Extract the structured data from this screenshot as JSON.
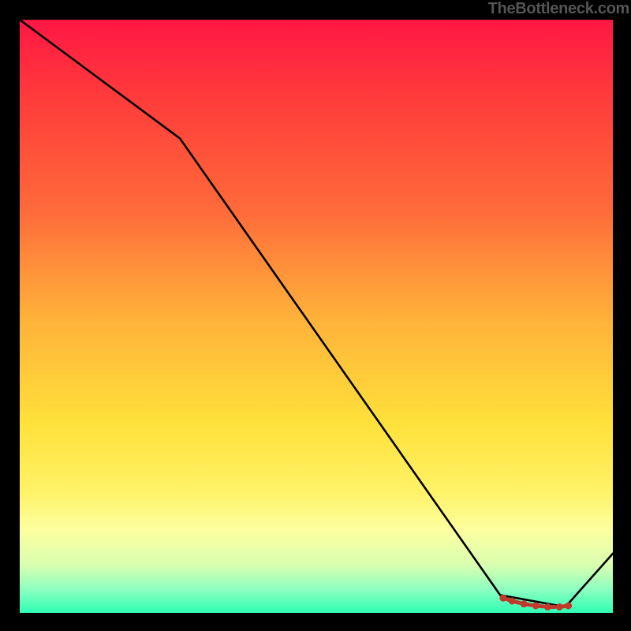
{
  "watermark": "TheBottleneck.com",
  "chart_data": {
    "type": "line",
    "title": "",
    "xlabel": "",
    "ylabel": "",
    "xlim": [
      0,
      100
    ],
    "ylim": [
      0,
      100
    ],
    "series": [
      {
        "name": "curve",
        "x": [
          0,
          27,
          81,
          92,
          100
        ],
        "y": [
          100,
          80,
          3,
          1,
          10
        ]
      }
    ],
    "markers": {
      "name": "highlight-segment",
      "points": [
        {
          "x": 81.5,
          "y": 2.5
        },
        {
          "x": 83,
          "y": 2.0
        },
        {
          "x": 85,
          "y": 1.5
        },
        {
          "x": 87,
          "y": 1.2
        },
        {
          "x": 89,
          "y": 1.0
        },
        {
          "x": 91,
          "y": 1.0
        },
        {
          "x": 92.5,
          "y": 1.2
        }
      ]
    },
    "gradient_stops": [
      {
        "pos": 0,
        "color": "#ff1744"
      },
      {
        "pos": 13,
        "color": "#ff3b3b"
      },
      {
        "pos": 32,
        "color": "#ff6a3a"
      },
      {
        "pos": 50,
        "color": "#ffb03a"
      },
      {
        "pos": 68,
        "color": "#ffe13a"
      },
      {
        "pos": 80,
        "color": "#fff36a"
      },
      {
        "pos": 86,
        "color": "#fdffa0"
      },
      {
        "pos": 92,
        "color": "#d8ffb0"
      },
      {
        "pos": 96,
        "color": "#8effc0"
      },
      {
        "pos": 100,
        "color": "#2effb5"
      }
    ]
  }
}
